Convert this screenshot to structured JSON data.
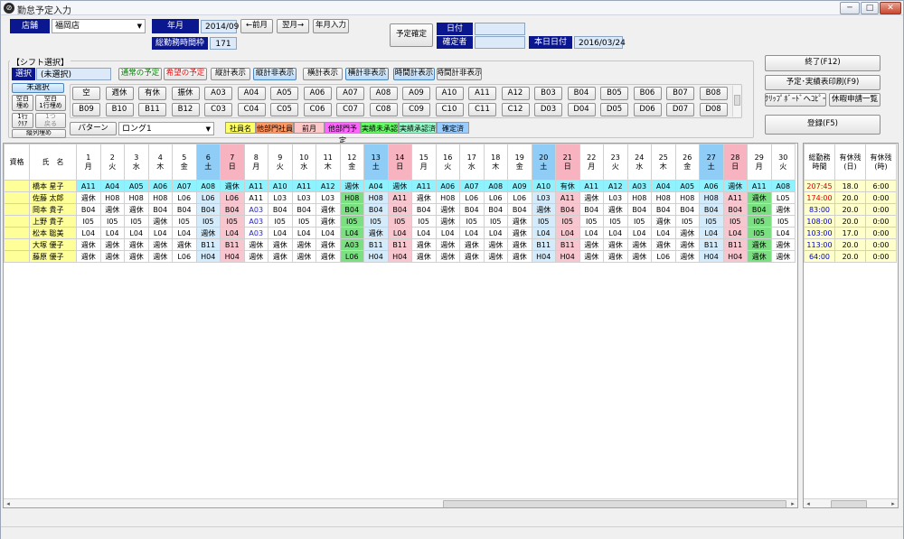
{
  "window": {
    "title": "勤怠予定入力",
    "icon": "app-logo-icon",
    "min": "─",
    "max": "□",
    "close": "✕"
  },
  "header": {
    "store_label": "店舗",
    "store_value": "福岡店",
    "ym_label": "年月",
    "ym_value": "2014/09",
    "prev_month": "←前月",
    "next_month": "翌月→",
    "ym_input": "年月入力",
    "total_label": "総勤務時間枠",
    "total_value": "171",
    "confirm_label": "予定確定",
    "date_label": "日付",
    "date_value": "",
    "confirmer_label": "確定者",
    "confirmer_value": "",
    "today_label": "本日日付",
    "today_value": "2016/03/24"
  },
  "right_buttons": {
    "end": "終了(F12)",
    "print": "予定･実績表印刷(F9)",
    "clipboard": "ｸﾘｯﾌﾟﾎﾞｰﾄﾞへｺﾋﾟｰ",
    "leave": "休暇申請一覧",
    "register": "登録(F5)"
  },
  "shift": {
    "section_label": "【シフト選択】",
    "select_label": "選択",
    "select_value": "(未選択)",
    "normal_plan": "通常の予定",
    "wish_plan": "希望の予定",
    "vert_show": "縦計表示",
    "vert_hide": "縦計非表示",
    "horz_show": "横計表示",
    "horz_hide": "横計非表示",
    "time_show": "時間計表示",
    "time_hide": "時間計非表示",
    "unselected": "未選択",
    "blank_fill": "空白\n埋め",
    "blank_fill_row": "空白\n1行埋め",
    "row_clear": "1行\nｸﾘｱ",
    "undo": "1つ\n戻る",
    "col_fill": "縦列埋め",
    "pattern_btn": "パターン",
    "pattern_value": "ロング1",
    "row1": [
      "空",
      "週休",
      "有休",
      "振休",
      "A03",
      "A04",
      "A05",
      "A06",
      "A07",
      "A08",
      "A09",
      "A10",
      "A11",
      "A12",
      "B03",
      "B04",
      "B05",
      "B06",
      "B07",
      "B08"
    ],
    "row2": [
      "B09",
      "B10",
      "B11",
      "B12",
      "C03",
      "C04",
      "C05",
      "C06",
      "C07",
      "C08",
      "C09",
      "C10",
      "C11",
      "C12",
      "D03",
      "D04",
      "D05",
      "D06",
      "D07",
      "D08"
    ]
  },
  "legend": {
    "staff": "社員名",
    "other_staff": "他部門社員",
    "prev_month": "前月",
    "other_plan": "他部門予定",
    "not_approved": "実績未承認",
    "approved": "実績承認済",
    "confirmed": "確定済"
  },
  "legend_colors": {
    "staff": "#ffff66",
    "other_staff": "#ff9966",
    "prev_month": "#ffc9c9",
    "other_plan": "#ff66ff",
    "not_approved": "#66ff66",
    "approved": "#99ffcc",
    "confirmed": "#99ccff"
  },
  "grid": {
    "h_qual": "資格",
    "h_name": "氏　名",
    "days": [
      {
        "d": "1",
        "w": "月"
      },
      {
        "d": "2",
        "w": "火"
      },
      {
        "d": "3",
        "w": "水"
      },
      {
        "d": "4",
        "w": "木"
      },
      {
        "d": "5",
        "w": "金"
      },
      {
        "d": "6",
        "w": "土"
      },
      {
        "d": "7",
        "w": "日"
      },
      {
        "d": "8",
        "w": "月"
      },
      {
        "d": "9",
        "w": "火"
      },
      {
        "d": "10",
        "w": "水"
      },
      {
        "d": "11",
        "w": "木"
      },
      {
        "d": "12",
        "w": "金"
      },
      {
        "d": "13",
        "w": "土"
      },
      {
        "d": "14",
        "w": "日"
      },
      {
        "d": "15",
        "w": "月"
      },
      {
        "d": "16",
        "w": "火"
      },
      {
        "d": "17",
        "w": "水"
      },
      {
        "d": "18",
        "w": "木"
      },
      {
        "d": "19",
        "w": "金"
      },
      {
        "d": "20",
        "w": "土"
      },
      {
        "d": "21",
        "w": "日"
      },
      {
        "d": "22",
        "w": "月"
      },
      {
        "d": "23",
        "w": "火"
      },
      {
        "d": "24",
        "w": "水"
      },
      {
        "d": "25",
        "w": "木"
      },
      {
        "d": "26",
        "w": "金"
      },
      {
        "d": "27",
        "w": "土"
      },
      {
        "d": "28",
        "w": "日"
      },
      {
        "d": "29",
        "w": "月"
      },
      {
        "d": "30",
        "w": "火"
      }
    ],
    "rows": [
      {
        "name": "橋本 星子",
        "cells": [
          "A11",
          "A04",
          "A05",
          "A06",
          "A07",
          "A08",
          "週休",
          "A11",
          "A10",
          "A11",
          "A12",
          "週休",
          "A04",
          "週休",
          "A11",
          "A06",
          "A07",
          "A08",
          "A09",
          "A10",
          "有休",
          "A11",
          "A12",
          "A03",
          "A04",
          "A05",
          "A06",
          "週休",
          "A11",
          "A08"
        ]
      },
      {
        "name": "佐藤 太郎",
        "cells": [
          "週休",
          "H08",
          "H08",
          "H08",
          "L06",
          "L06",
          "L06",
          "A11",
          "L03",
          "L03",
          "L03",
          "H08",
          "H08",
          "A11",
          "週休",
          "H08",
          "L06",
          "L06",
          "L06",
          "L03",
          "A11",
          "週休",
          "L03",
          "H08",
          "H08",
          "H08",
          "H08",
          "A11",
          "週休",
          "L05"
        ]
      },
      {
        "name": "岡本 貴子",
        "cells": [
          "B04",
          "週休",
          "週休",
          "B04",
          "B04",
          "B04",
          "B04",
          "A03",
          "B04",
          "B04",
          "週休",
          "B04",
          "B04",
          "B04",
          "B04",
          "週休",
          "B04",
          "B04",
          "B04",
          "週休",
          "B04",
          "B04",
          "週休",
          "B04",
          "B04",
          "B04",
          "B04",
          "B04",
          "B04",
          "週休"
        ]
      },
      {
        "name": "上野 貴子",
        "cells": [
          "I05",
          "I05",
          "I05",
          "週休",
          "I05",
          "I05",
          "I05",
          "A03",
          "I05",
          "I05",
          "週休",
          "I05",
          "I05",
          "I05",
          "I05",
          "週休",
          "I05",
          "I05",
          "週休",
          "I05",
          "I05",
          "I05",
          "I05",
          "I05",
          "週休",
          "I05",
          "I05",
          "I05",
          "I05",
          "I05"
        ]
      },
      {
        "name": "松本 聡美",
        "cells": [
          "L04",
          "L04",
          "L04",
          "L04",
          "L04",
          "週休",
          "L04",
          "A03",
          "L04",
          "L04",
          "L04",
          "L04",
          "週休",
          "L04",
          "L04",
          "L04",
          "L04",
          "L04",
          "週休",
          "L04",
          "L04",
          "L04",
          "L04",
          "L04",
          "L04",
          "週休",
          "L04",
          "L04",
          "I05",
          "L04"
        ]
      },
      {
        "name": "大塚 優子",
        "cells": [
          "週休",
          "週休",
          "週休",
          "週休",
          "週休",
          "B11",
          "B11",
          "週休",
          "週休",
          "週休",
          "週休",
          "A03",
          "B11",
          "B11",
          "週休",
          "週休",
          "週休",
          "週休",
          "週休",
          "B11",
          "B11",
          "週休",
          "週休",
          "週休",
          "週休",
          "週休",
          "B11",
          "B11",
          "週休",
          "週休"
        ]
      },
      {
        "name": "藤原 優子",
        "cells": [
          "週休",
          "週休",
          "週休",
          "週休",
          "L06",
          "H04",
          "H04",
          "週休",
          "週休",
          "週休",
          "週休",
          "L06",
          "H04",
          "H04",
          "週休",
          "週休",
          "週休",
          "週休",
          "週休",
          "H04",
          "H04",
          "週休",
          "週休",
          "週休",
          "L06",
          "週休",
          "H04",
          "H04",
          "週休",
          "週休"
        ]
      }
    ]
  },
  "summary": {
    "h_total": "総勤務\n時間",
    "h_leave_day": "有休残\n(日)",
    "h_leave_hour": "有休残\n(時)",
    "rows": [
      {
        "total": "207:45",
        "day": "18.0",
        "hour": "6:00"
      },
      {
        "total": "174:00",
        "day": "20.0",
        "hour": "0:00"
      },
      {
        "total": "83:00",
        "day": "20.0",
        "hour": "0:00"
      },
      {
        "total": "108:00",
        "day": "20.0",
        "hour": "0:00"
      },
      {
        "total": "103:00",
        "day": "17.0",
        "hour": "0:00"
      },
      {
        "total": "113:00",
        "day": "20.0",
        "hour": "0:00"
      },
      {
        "total": "64:00",
        "day": "20.0",
        "hour": "0:00"
      }
    ]
  }
}
